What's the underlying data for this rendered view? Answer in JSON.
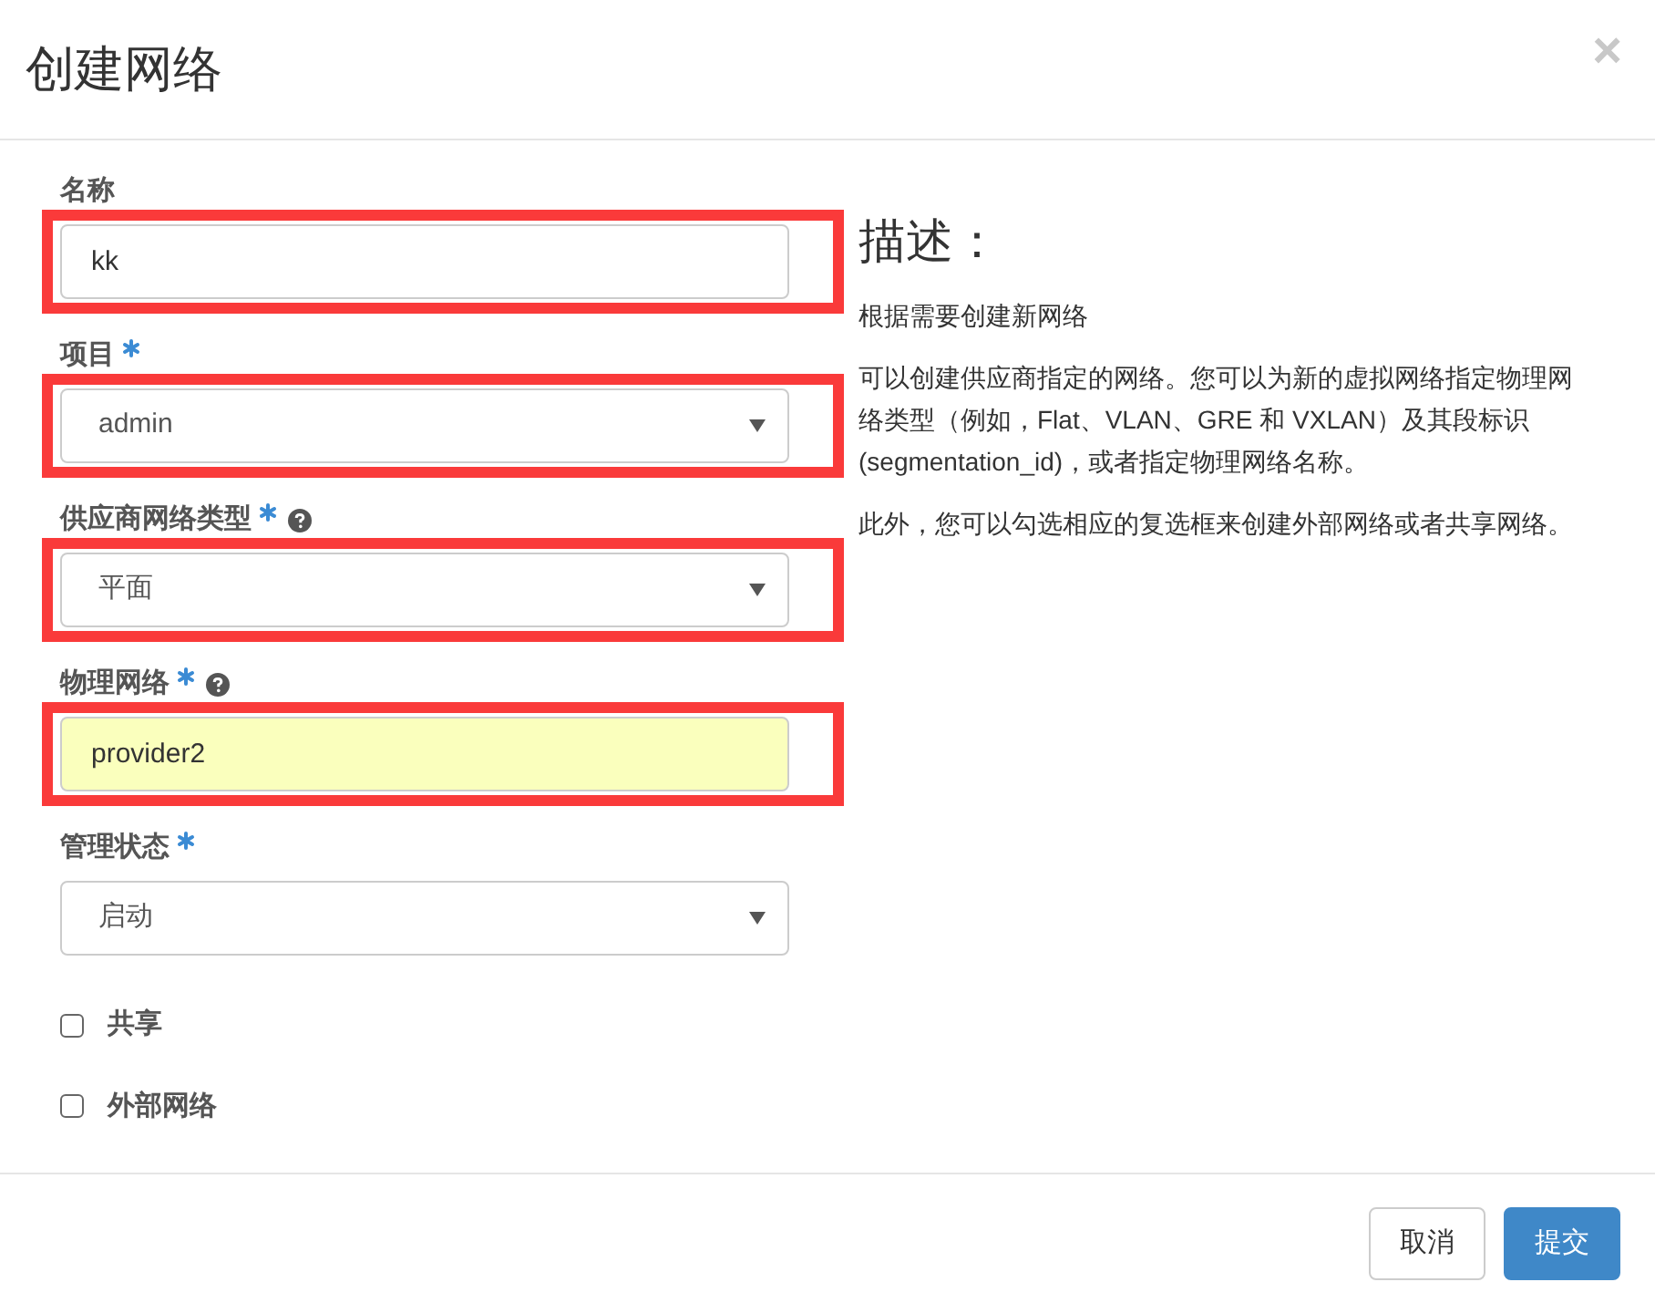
{
  "dialog": {
    "title": "创建网络",
    "close": "×"
  },
  "fields": [
    {
      "kind": "text",
      "label": "名称",
      "required": false,
      "help": false,
      "value": "kk",
      "autofilled": false,
      "highlighted": true
    },
    {
      "kind": "select",
      "label": "项目",
      "required": true,
      "help": false,
      "value": "admin",
      "autofilled": false,
      "highlighted": true
    },
    {
      "kind": "select",
      "label": "供应商网络类型",
      "required": true,
      "help": true,
      "value": "平面",
      "autofilled": false,
      "highlighted": true
    },
    {
      "kind": "text",
      "label": "物理网络",
      "required": true,
      "help": true,
      "value": "provider2",
      "autofilled": true,
      "highlighted": true
    },
    {
      "kind": "select",
      "label": "管理状态",
      "required": true,
      "help": false,
      "value": "启动",
      "autofilled": false,
      "highlighted": false
    }
  ],
  "checkboxes": [
    {
      "label": "共享",
      "checked": false
    },
    {
      "label": "外部网络",
      "checked": false
    }
  ],
  "description": {
    "heading": "描述：",
    "paragraphs": [
      "根据需要创建新网络",
      "可以创建供应商指定的网络。您可以为新的虚拟网络指定物理网络类型（例如，Flat、VLAN、GRE 和 VXLAN）及其段标识 (segmentation_id)，或者指定物理网络名称。",
      "此外，您可以勾选相应的复选框来创建外部网络或者共享网络。"
    ]
  },
  "buttons": [
    {
      "label": "取消",
      "kind": "default"
    },
    {
      "label": "提交",
      "kind": "primary"
    }
  ]
}
